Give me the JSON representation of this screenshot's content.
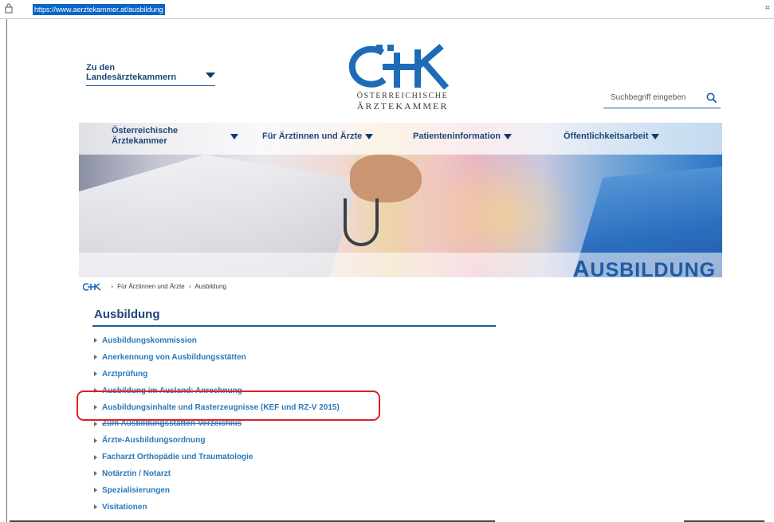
{
  "browser": {
    "url": "https://www.aerztekammer.at/ausbildung",
    "grid_icon": "⌗"
  },
  "header": {
    "lk_toggle": "Zu den Landesärztekammern",
    "logo_line1": "ÖSTERREICHISCHE",
    "logo_line2": "ÄRZTEKAMMER",
    "search_placeholder": "Suchbegriff eingeben"
  },
  "nav": {
    "items": [
      "Österreichische Ärztekammer",
      "Für Ärztinnen und Ärzte",
      "Patienteninformation",
      "Öffentlichkeitsarbeit"
    ]
  },
  "hero": {
    "title_first": "A",
    "title_rest": "USBILDUNG"
  },
  "breadcrumb": {
    "sep": "›",
    "items": [
      "Für Ärztinnen und Ärzte",
      "Ausbildung"
    ]
  },
  "content": {
    "heading": "Ausbildung",
    "links": [
      "Ausbildungskommission",
      "Anerkennung von Ausbildungsstätten",
      "Arztprüfung",
      "Ausbildung im Ausland: Anrechnung",
      "Ausbildungsinhalte und Rasterzeugnisse (KEF und RZ-V 2015)",
      "Zum Ausbildungsstätten-Verzeichnis",
      "Ärzte-Ausbildungsordnung",
      "Facharzt Orthopädie und Traumatologie",
      "Notärztin / Notarzt",
      "Spezialisierungen",
      "Visitationen"
    ]
  },
  "colors": {
    "brand_blue": "#1e5aa0",
    "link_blue": "#2a78b8",
    "highlight_red": "#e02020"
  }
}
